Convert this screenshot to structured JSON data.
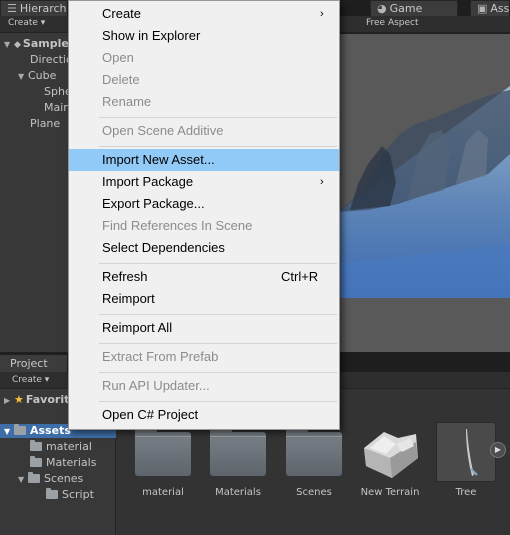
{
  "tabs": {
    "hierarchy": "Hierarchy",
    "game": "Game",
    "assets_tab": "Asse"
  },
  "hierarchy": {
    "create_label": "Create",
    "items": [
      {
        "label": "SampleScene",
        "expanded": true
      },
      {
        "label": "Directional Light"
      },
      {
        "label": "Cube",
        "expanded": true
      },
      {
        "label": "Sphere"
      },
      {
        "label": "Main Camera"
      },
      {
        "label": "Plane"
      }
    ]
  },
  "game_view": {
    "aspect_label": "Free Aspect"
  },
  "project": {
    "tab_label": "Project",
    "create_label": "Create",
    "tree": [
      {
        "label": "Favorites"
      },
      {
        "label": "Assets",
        "selected": true
      },
      {
        "label": "material"
      },
      {
        "label": "Materials"
      },
      {
        "label": "Scenes"
      },
      {
        "label": "Script"
      }
    ],
    "assets": [
      {
        "label": "material",
        "icon": "folder-icon"
      },
      {
        "label": "Materials",
        "icon": "folder-icon"
      },
      {
        "label": "Scenes",
        "icon": "folder-icon"
      },
      {
        "label": "New Terrain",
        "icon": "terrain-icon"
      },
      {
        "label": "Tree",
        "icon": "tree-icon"
      }
    ]
  },
  "context_menu": {
    "items": [
      {
        "label": "Create",
        "submenu": true
      },
      {
        "label": "Show in Explorer"
      },
      {
        "label": "Open",
        "disabled": true
      },
      {
        "label": "Delete",
        "disabled": true
      },
      {
        "label": "Rename",
        "disabled": true
      },
      {
        "label": "Open Scene Additive",
        "disabled": true
      },
      {
        "label": "Import New Asset...",
        "highlighted": true
      },
      {
        "label": "Import Package",
        "submenu": true
      },
      {
        "label": "Export Package..."
      },
      {
        "label": "Find References In Scene",
        "disabled": true
      },
      {
        "label": "Select Dependencies"
      },
      {
        "label": "Refresh",
        "shortcut": "Ctrl+R"
      },
      {
        "label": "Reimport"
      },
      {
        "label": "Reimport All"
      },
      {
        "label": "Extract From Prefab",
        "disabled": true
      },
      {
        "label": "Run API Updater...",
        "disabled": true
      },
      {
        "label": "Open C# Project"
      }
    ]
  },
  "colors": {
    "menu_highlight": "#91c9f7",
    "selection_blue": "#3e6ea8",
    "panel_bg": "#383838"
  }
}
